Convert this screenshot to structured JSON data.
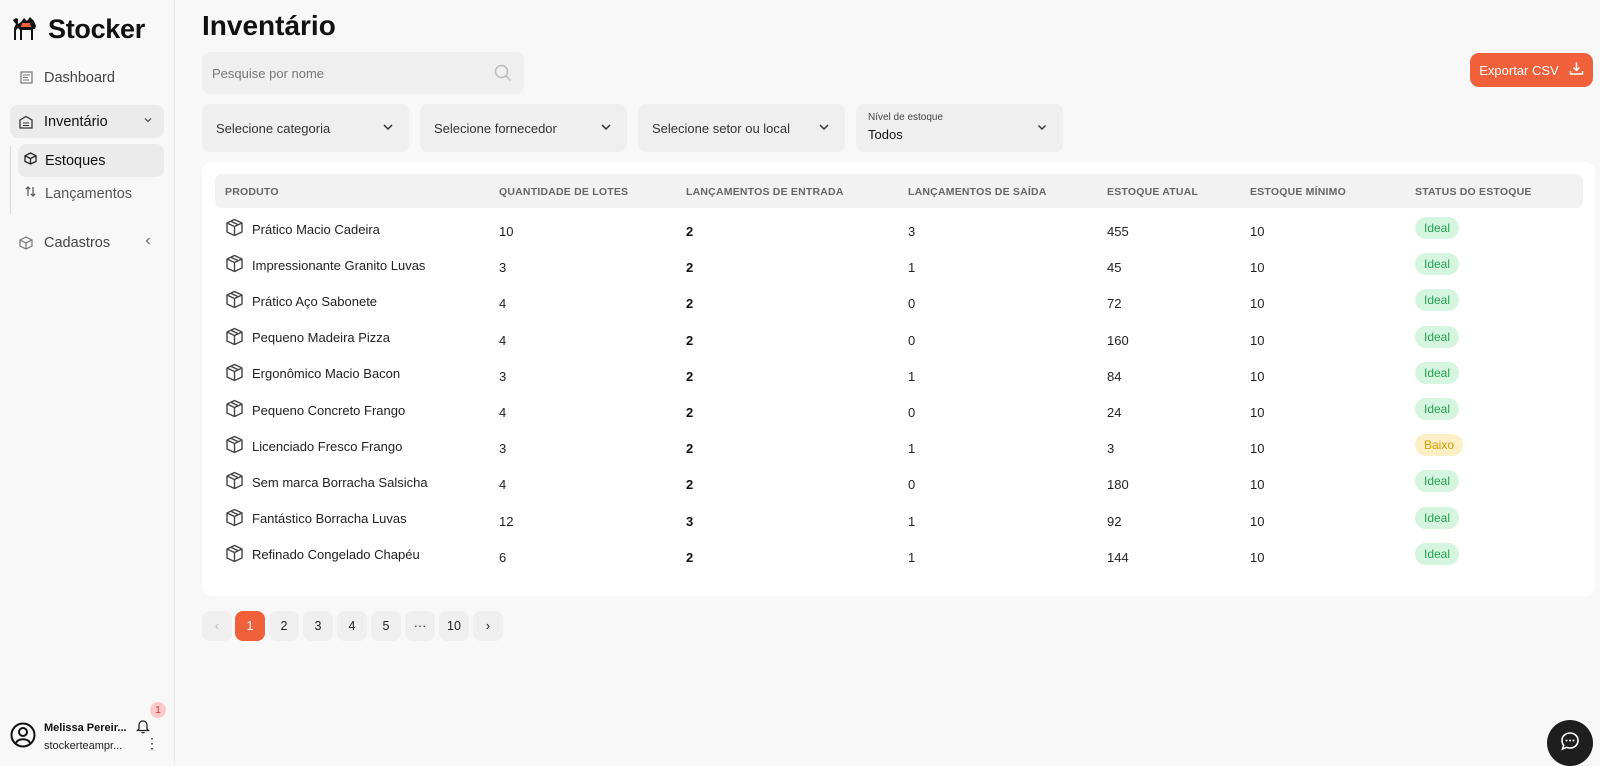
{
  "brand": {
    "name": "Stocker"
  },
  "sidebar": {
    "items": [
      {
        "label": "Dashboard"
      },
      {
        "label": "Inventário"
      },
      {
        "label": "Cadastros"
      }
    ],
    "subitems": [
      {
        "label": "Estoques"
      },
      {
        "label": "Lançamentos"
      }
    ]
  },
  "user": {
    "name": "Melissa Pereir...",
    "email": "stockerteampr...",
    "notifications": "1"
  },
  "page": {
    "title": "Inventário"
  },
  "search": {
    "placeholder": "Pesquise por nome",
    "value": ""
  },
  "export": {
    "label": "Exportar CSV"
  },
  "filters": {
    "category": "Selecione categoria",
    "supplier": "Selecione fornecedor",
    "sector": "Selecione setor ou local",
    "level": {
      "label": "Nível de estoque",
      "value": "Todos"
    }
  },
  "table": {
    "headers": [
      "PRODUTO",
      "QUANTIDADE DE LOTES",
      "LANÇAMENTOS DE ENTRADA",
      "LANÇAMENTOS DE SAÍDA",
      "ESTOQUE ATUAL",
      "ESTOQUE MÍNIMO",
      "STATUS DO ESTOQUE"
    ],
    "rows": [
      {
        "product": "Prático Macio Cadeira",
        "lots": "10",
        "in": "2",
        "out": "3",
        "current": "455",
        "min": "10",
        "status": "Ideal"
      },
      {
        "product": "Impressionante Granito Luvas",
        "lots": "3",
        "in": "2",
        "out": "1",
        "current": "45",
        "min": "10",
        "status": "Ideal"
      },
      {
        "product": "Prático Aço Sabonete",
        "lots": "4",
        "in": "2",
        "out": "0",
        "current": "72",
        "min": "10",
        "status": "Ideal"
      },
      {
        "product": "Pequeno Madeira Pizza",
        "lots": "4",
        "in": "2",
        "out": "0",
        "current": "160",
        "min": "10",
        "status": "Ideal"
      },
      {
        "product": "Ergonômico Macio Bacon",
        "lots": "3",
        "in": "2",
        "out": "1",
        "current": "84",
        "min": "10",
        "status": "Ideal"
      },
      {
        "product": "Pequeno Concreto Frango",
        "lots": "4",
        "in": "2",
        "out": "0",
        "current": "24",
        "min": "10",
        "status": "Ideal"
      },
      {
        "product": "Licenciado Fresco Frango",
        "lots": "3",
        "in": "2",
        "out": "1",
        "current": "3",
        "min": "10",
        "status": "Baixo"
      },
      {
        "product": "Sem marca Borracha Salsicha",
        "lots": "4",
        "in": "2",
        "out": "0",
        "current": "180",
        "min": "10",
        "status": "Ideal"
      },
      {
        "product": "Fantástico Borracha Luvas",
        "lots": "12",
        "in": "3",
        "out": "1",
        "current": "92",
        "min": "10",
        "status": "Ideal"
      },
      {
        "product": "Refinado Congelado Chapéu",
        "lots": "6",
        "in": "2",
        "out": "1",
        "current": "144",
        "min": "10",
        "status": "Ideal"
      }
    ]
  },
  "pagination": {
    "prev": "‹",
    "pages": [
      "1",
      "2",
      "3",
      "4",
      "5",
      "···",
      "10"
    ],
    "next": "›",
    "current": "1"
  },
  "colors": {
    "accent": "#f0603a",
    "ideal_bg": "#d6f5df",
    "ideal_text": "#25a155",
    "low_bg": "#fcefc5",
    "low_text": "#d99a00"
  }
}
